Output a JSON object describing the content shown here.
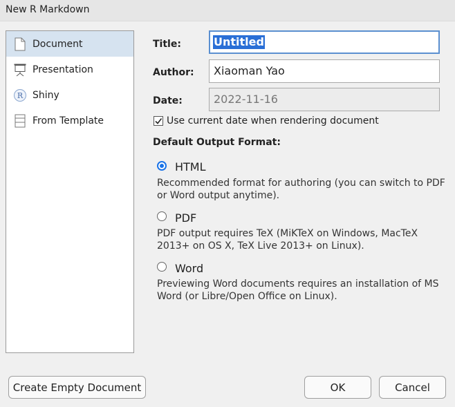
{
  "window": {
    "title": "New R Markdown"
  },
  "sidebar": {
    "items": [
      {
        "label": "Document",
        "icon": "document-icon",
        "selected": true
      },
      {
        "label": "Presentation",
        "icon": "presentation-icon",
        "selected": false
      },
      {
        "label": "Shiny",
        "icon": "shiny-r-icon",
        "selected": false
      },
      {
        "label": "From Template",
        "icon": "template-icon",
        "selected": false
      }
    ]
  },
  "form": {
    "title_label": "Title:",
    "title_value": "Untitled",
    "author_label": "Author:",
    "author_value": "Xiaoman Yao",
    "date_label": "Date:",
    "date_value": "2022-11-16",
    "use_current_date_label": "Use current date when rendering document",
    "use_current_date_checked": true,
    "output_format_heading": "Default Output Format:"
  },
  "formats": [
    {
      "label": "HTML",
      "selected": true,
      "description": "Recommended format for authoring (you can switch to PDF or Word output anytime)."
    },
    {
      "label": "PDF",
      "selected": false,
      "description": "PDF output requires TeX (MiKTeX on Windows, MacTeX 2013+ on OS X, TeX Live 2013+ on Linux)."
    },
    {
      "label": "Word",
      "selected": false,
      "description": "Previewing Word documents requires an installation of MS Word (or Libre/Open Office on Linux)."
    }
  ],
  "buttons": {
    "create_empty": "Create Empty Document",
    "ok": "OK",
    "cancel": "Cancel"
  },
  "colors": {
    "selection": "#2a6fd6",
    "sidebar_selected": "#d6e3f0",
    "radio_accent": "#1a73e8",
    "focus_border": "#5a8fd0"
  }
}
